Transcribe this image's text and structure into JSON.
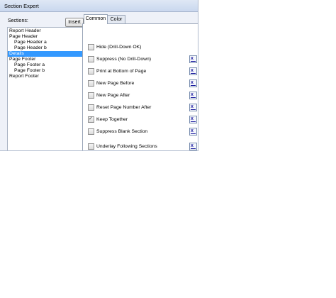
{
  "window": {
    "title": "Section Expert",
    "minimize": "–",
    "maximize": "□",
    "close": "✕"
  },
  "sections": {
    "label": "Sections:",
    "insert_button": "Insert",
    "items": [
      {
        "label": "Report Header",
        "level": 0,
        "selected": false
      },
      {
        "label": "Page Header",
        "level": 0,
        "selected": false
      },
      {
        "label": "Page Header a",
        "level": 1,
        "selected": false
      },
      {
        "label": "Page Header b",
        "level": 1,
        "selected": false
      },
      {
        "label": "Details",
        "level": 0,
        "selected": true
      },
      {
        "label": "Page Footer",
        "level": 0,
        "selected": false
      },
      {
        "label": "Page Footer a",
        "level": 1,
        "selected": false
      },
      {
        "label": "Page Footer b",
        "level": 1,
        "selected": false
      },
      {
        "label": "Report Footer",
        "level": 0,
        "selected": false
      }
    ]
  },
  "tabs": [
    {
      "label": "Common",
      "active": true
    },
    {
      "label": "Color",
      "active": false
    }
  ],
  "options": [
    {
      "label": "Hide (Drill-Down OK)",
      "checked": false,
      "formula": false
    },
    {
      "label": "Suppress (No Drill-Down)",
      "checked": false,
      "formula": true
    },
    {
      "label": "Print at Bottom of Page",
      "checked": false,
      "formula": true
    },
    {
      "label": "New Page Before",
      "checked": false,
      "formula": true
    },
    {
      "label": "New Page After",
      "checked": false,
      "formula": true
    },
    {
      "label": "Reset Page Number After",
      "checked": false,
      "formula": true
    },
    {
      "label": "Keep Together",
      "checked": true,
      "formula": true
    },
    {
      "label": "Suppress Blank Section",
      "checked": false,
      "formula": true
    },
    {
      "label": "Underlay Following Sections",
      "checked": false,
      "formula": true
    }
  ],
  "icons": {
    "formula_button": "formula-x-icon",
    "check": "✓"
  }
}
